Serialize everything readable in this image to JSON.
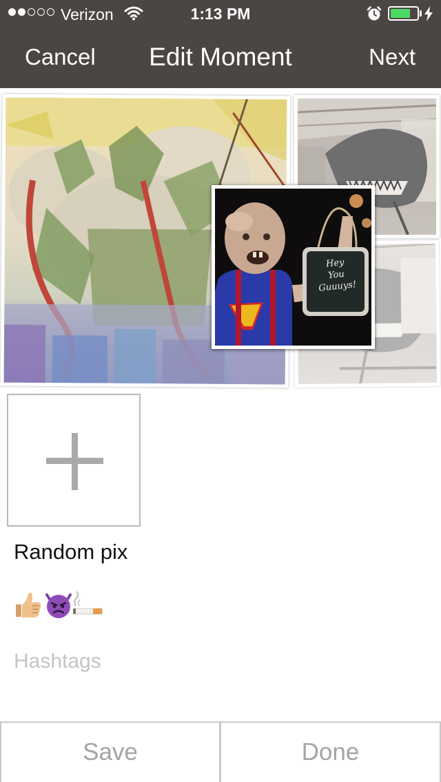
{
  "status_bar": {
    "signal_dots": 5,
    "signal_filled": 2,
    "carrier": "Verizon",
    "wifi_icon": "wifi-icon",
    "time": "1:13 PM",
    "alarm_icon": "alarm-clock-icon",
    "battery_level": 0.75,
    "charging_icon": "charging-bolt-icon"
  },
  "nav": {
    "cancel_label": "Cancel",
    "title": "Edit Moment",
    "next_label": "Next"
  },
  "collage": {
    "photos": [
      {
        "name": "comic-dragon-photo"
      },
      {
        "name": "hangar-shark-photo"
      },
      {
        "name": "hangar-shark-photo-faded"
      },
      {
        "name": "costume-sign-photo",
        "sign_text": [
          "Hey",
          "You",
          "Guuuys!"
        ]
      }
    ]
  },
  "add_photo": {
    "icon": "plus-icon"
  },
  "moment": {
    "title": "Random pix",
    "emoji": [
      "👍",
      "👿",
      "🚬"
    ],
    "hashtags_placeholder": "Hashtags"
  },
  "actions": {
    "save_label": "Save",
    "done_label": "Done"
  },
  "colors": {
    "header_bg": "#4b4644",
    "battery_green": "#4cd964",
    "muted_text": "#a4a4a4",
    "placeholder_text": "#c4c4c4"
  }
}
